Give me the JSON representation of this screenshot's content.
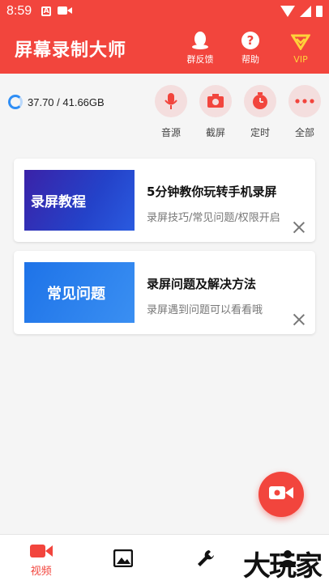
{
  "statusbar": {
    "time": "8:59",
    "icon_a": "A"
  },
  "header": {
    "title": "屏幕录制大师",
    "actions": [
      {
        "label": "群反馈",
        "icon": "qq-penguin-icon"
      },
      {
        "label": "帮助",
        "icon": "help-icon",
        "glyph": "?"
      },
      {
        "label": "VIP",
        "icon": "vip-diamond-icon"
      }
    ]
  },
  "storage": {
    "text": "37.70 / 41.66GB"
  },
  "tools": [
    {
      "label": "音源",
      "icon": "microphone-icon"
    },
    {
      "label": "截屏",
      "icon": "camera-icon"
    },
    {
      "label": "定时",
      "icon": "timer-icon"
    },
    {
      "label": "全部",
      "icon": "more-icon"
    }
  ],
  "cards": [
    {
      "thumb_text": "录屏教程",
      "title": "5分钟教你玩转手机录屏",
      "subtitle": "录屏技巧/常见问题/权限开启"
    },
    {
      "thumb_text": "常见问题",
      "title": "录屏问题及解决方法",
      "subtitle": "录屏遇到问题可以看看哦"
    }
  ],
  "bottom_nav": [
    {
      "label": "视频",
      "icon": "video-icon",
      "active": true
    },
    {
      "label": "",
      "icon": "image-icon",
      "active": false
    },
    {
      "label": "",
      "icon": "wrench-icon",
      "active": false
    },
    {
      "label": "",
      "icon": "profile-icon",
      "active": false
    }
  ],
  "watermark": "大玩家",
  "colors": {
    "primary": "#f2453d",
    "accent_blue": "#2f8ef5",
    "vip_gold": "#ffd23a"
  }
}
